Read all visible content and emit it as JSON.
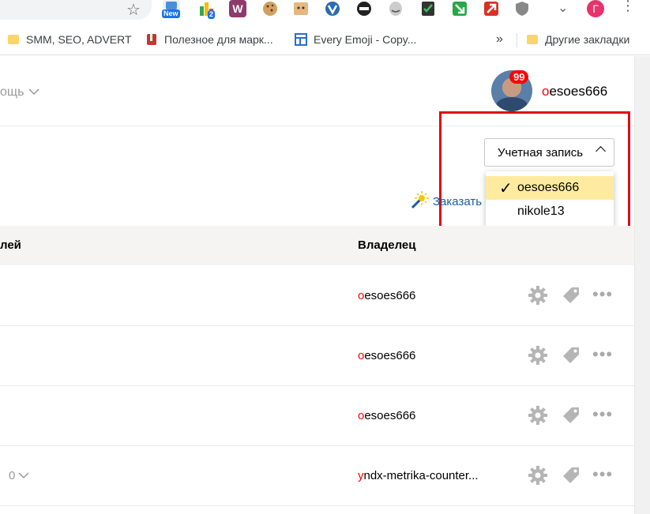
{
  "browser": {
    "extensions": [
      {
        "icon": "new-extension-icon",
        "badge": "New",
        "color": "#1a73e8"
      },
      {
        "icon": "analytics-extension-icon",
        "badge": "2",
        "color": "#f4b400"
      },
      {
        "icon": "w-extension-icon",
        "label": "W",
        "color": "#8e3a6d"
      },
      {
        "icon": "cookie-extension-icon",
        "color": "#c68642"
      },
      {
        "icon": "face-extension-icon",
        "color": "#d9a066"
      },
      {
        "icon": "v-extension-icon",
        "color": "#2b6cb0"
      },
      {
        "icon": "ninja-extension-icon",
        "color": "#222222"
      },
      {
        "icon": "mask-extension-icon",
        "color": "#777777"
      },
      {
        "icon": "checklist-extension-icon",
        "color": "#333333"
      },
      {
        "icon": "green-arrow-extension-icon",
        "color": "#27a844"
      },
      {
        "icon": "red-arrow-extension-icon",
        "color": "#d93025"
      },
      {
        "icon": "shield-extension-icon",
        "color": "#777777"
      }
    ],
    "profile_letter": "Г"
  },
  "bookmarks": {
    "items": [
      {
        "label": "SMM, SEO, ADVERT",
        "icon": "folder-icon"
      },
      {
        "label": "Полезное для марк...",
        "icon": "bookmark-red-icon"
      },
      {
        "label": "Every Emoji - Copy...",
        "icon": "window-blue-icon"
      }
    ],
    "overflow": "»",
    "other": {
      "label": "Другие закладки",
      "icon": "folder-icon"
    }
  },
  "header": {
    "help_label": "ощь",
    "notifications": "99",
    "user_login_first": "o",
    "user_login_rest": "esoes666"
  },
  "account_menu": {
    "button_label": "Учетная запись",
    "selected": "oesoes666",
    "options": [
      "oesoes666",
      "nikole13"
    ]
  },
  "order_link": "Заказать",
  "table": {
    "col_left": "лей",
    "col_owner": "Владелец",
    "rows": [
      {
        "owner_first": "o",
        "owner_rest": "esoes666",
        "sub": ""
      },
      {
        "owner_first": "o",
        "owner_rest": "esoes666",
        "sub": ""
      },
      {
        "owner_first": "o",
        "owner_rest": "esoes666",
        "sub": ""
      },
      {
        "owner_first": "y",
        "owner_rest": "ndx-metrika-counter...",
        "sub": "0"
      }
    ]
  },
  "colors": {
    "accent_red": "#ff0000",
    "highlight_border": "#e30613",
    "selected_bg": "#ffeba0",
    "link_blue": "#1a5fa0"
  }
}
